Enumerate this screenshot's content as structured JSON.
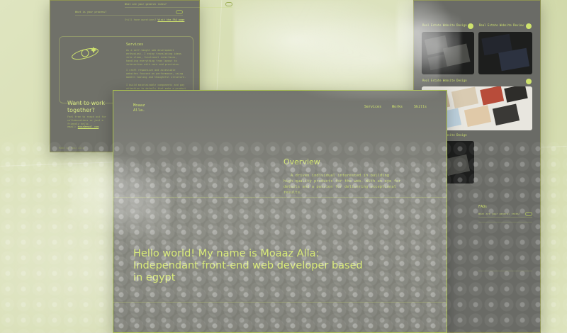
{
  "left_page": {
    "faq": [
      {
        "q": "What are your general rates?"
      },
      {
        "q": "What is your process?"
      }
    ],
    "more_questions": "Still have questions?",
    "more_questions_link": "Visit the FAQ page",
    "services": {
      "title": "Services",
      "paragraphs": [
        "As a self-taught web development enthusiast, I enjoy translating ideas into clean, functional interfaces, handling everything from layout to interaction with care and precision.",
        "I craft responsive and accessible websites focused on performance, using modern tooling and thoughtful structure.",
        "I build maintainable components and pay attention to details that make a product feel polished."
      ]
    },
    "cta": {
      "title": "Want to work together?",
      "body": "Feel free to reach out for collaborations or just a friendly hello.",
      "email_label": "email:",
      "email": "moaz@email.com"
    },
    "footer": "Made by Moaz Alla"
  },
  "right_page": {
    "projects": [
      {
        "title": "Real Estate Website Design",
        "subtitle": "Landing page / UI design"
      },
      {
        "title": "Real Estate Website Review",
        "subtitle": "Landing page / UI design"
      },
      {
        "title": "Real Estate Website Design",
        "subtitle": "Landing page / UI design"
      },
      {
        "title": "Real Estate Website Design",
        "subtitle": "Landing page / UI design"
      }
    ],
    "faq_title": "FAQs",
    "faq_q": "What are your general rates?"
  },
  "main_page": {
    "logo_line1": "Moaaz",
    "logo_line2": "Alla.",
    "nav": [
      "Services",
      "Works",
      "Skills"
    ],
    "overview_title": "Overview",
    "overview_body": "A driven individual interested in building high-quality products for the web. With an eye for details and a passion for delivering exceptional results.",
    "hero": "Hello world! My name is Moaaz Alla: Independant front-end web developer based in egypt"
  }
}
